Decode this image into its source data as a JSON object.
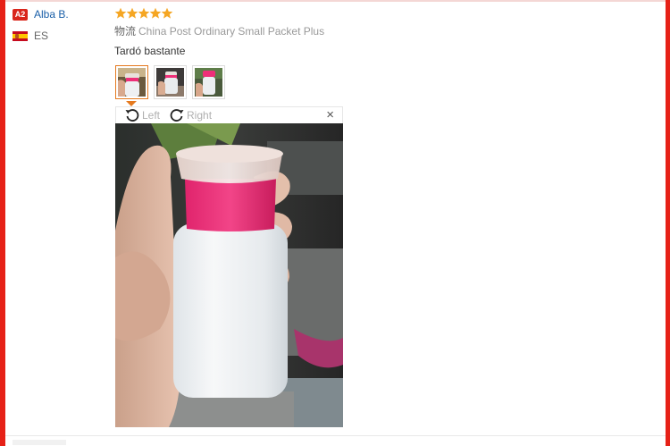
{
  "reviewer": {
    "level_badge": "A2",
    "name": "Alba B.",
    "country_code": "ES",
    "flag_icon": "spain-flag-icon"
  },
  "review": {
    "rating": 5,
    "rating_max": 5,
    "star_color": "#f5a623",
    "shipping_label": "物流",
    "shipping_method": "China Post Ordinary Small Packet Plus",
    "text": "Tardó bastante"
  },
  "photos": {
    "count": 3,
    "selected_index": 0
  },
  "viewer": {
    "rotate_left_label": "Left",
    "rotate_right_label": "Right",
    "close_label": "×"
  },
  "colors": {
    "frame_red": "#e62117",
    "link_blue": "#1a5fa8",
    "badge_red": "#d9261c",
    "selected_orange": "#e5791e",
    "bottle_pink": "#ee2f78"
  }
}
